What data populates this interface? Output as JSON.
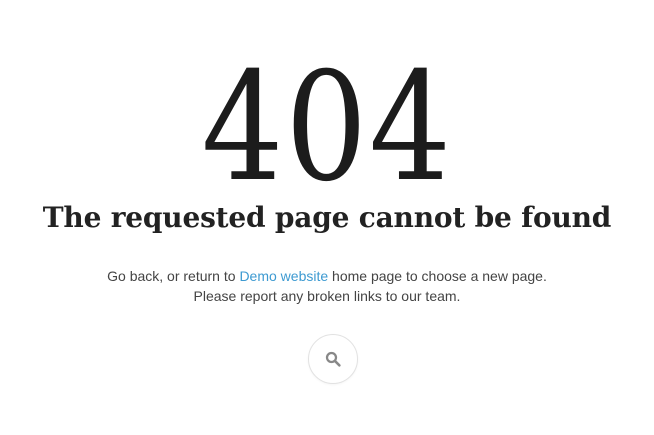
{
  "error": {
    "code": "404",
    "title": "The requested page cannot be found"
  },
  "message": {
    "line1_before": "Go back, or return to ",
    "line1_link": "Demo website",
    "line1_after": " home page to choose a new page.",
    "line2": "Please report any broken links to our team."
  },
  "search": {
    "icon": "search-icon"
  },
  "colors": {
    "link": "#3d9ad1",
    "text": "#222222",
    "icon": "#888888"
  }
}
